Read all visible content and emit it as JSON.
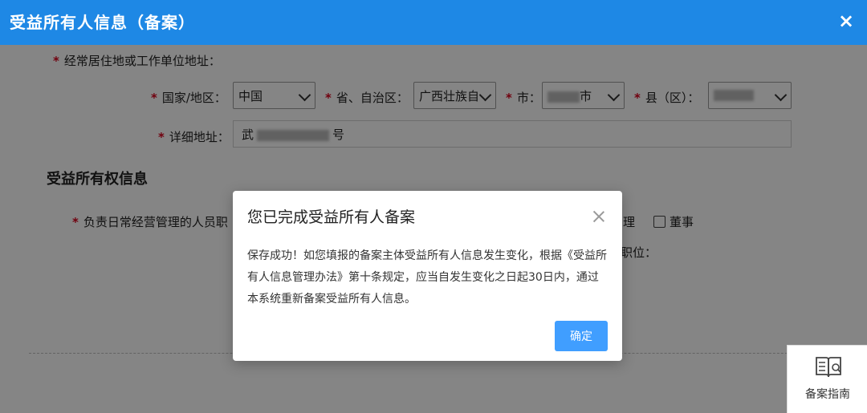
{
  "window": {
    "title": "受益所有人信息（备案）",
    "close_glyph": "×"
  },
  "address": {
    "section_label": "经常居住地或工作单位地址：",
    "country_label": "国家/地区：",
    "country_value": "中国",
    "province_label": "省、自治区：",
    "province_value": "广西壮族自",
    "city_label": "市：",
    "city_value": "市",
    "county_label": "县（区）：",
    "county_value": "",
    "detail_label": "详细地址：",
    "detail_value_prefix": "武",
    "detail_value_suffix": "号"
  },
  "ownership": {
    "section_title": "受益所有权信息",
    "daily_mgmt_label": "负责日常经营管理的人员职",
    "option_manager_partial": "理",
    "option_director": "董事",
    "position_label_partial": "职位："
  },
  "required_mark": "*",
  "guide": {
    "label": "备案指南",
    "icon": "guide-book-icon"
  },
  "dialog": {
    "title": "您已完成受益所有人备案",
    "message": "保存成功！如您填报的备案主体受益所有人信息发生变化，根据《受益所有人信息管理办法》第十条规定，应当自发生变化之日起30日内，通过本系统重新备案受益所有人信息。",
    "confirm_label": "确定"
  },
  "colors": {
    "header_bg": "#1e88e5",
    "required_star": "#d9001b",
    "primary_button": "#409eff"
  }
}
